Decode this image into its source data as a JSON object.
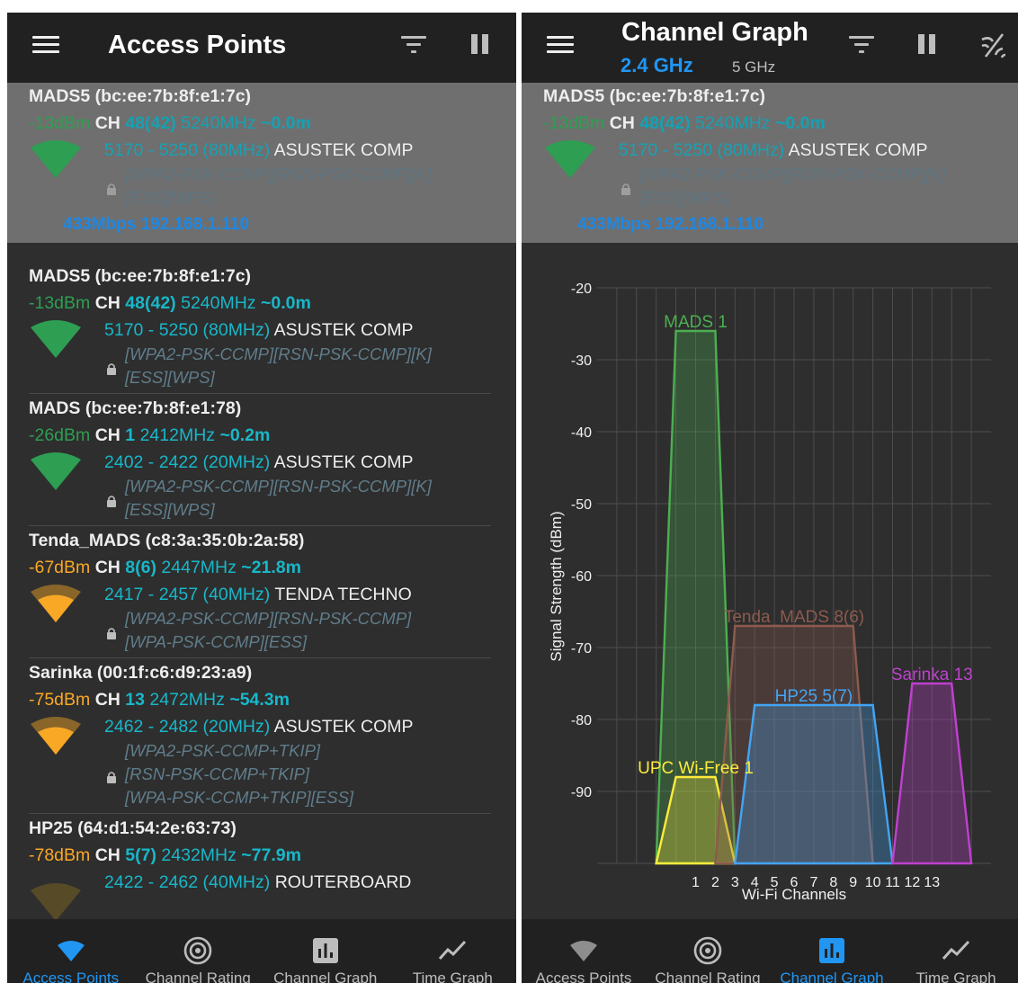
{
  "left_screen": {
    "title": "Access Points",
    "access_points": [
      {
        "name": "MADS5 (bc:ee:7b:8f:e1:7c)",
        "signal": "-13dBm",
        "ch_label": "CH",
        "channel": "48(42)",
        "frequency": "5240MHz",
        "distance": "~0.0m",
        "range": "5170 - 5250 (80MHz)",
        "vendor": "ASUSTEK COMP",
        "security_1": "[WPA2-PSK-CCMP][RSN-PSK-CCMP][K]",
        "security_2": "[ESS][WPS]",
        "extra": "433Mbps 192.168.1.110",
        "strength_color": "#2e9e52"
      },
      {
        "name": "MADS5 (bc:ee:7b:8f:e1:7c)",
        "signal": "-13dBm",
        "ch_label": "CH",
        "channel": "48(42)",
        "frequency": "5240MHz",
        "distance": "~0.0m",
        "range": "5170 - 5250 (80MHz)",
        "vendor": "ASUSTEK COMP",
        "security_1": "[WPA2-PSK-CCMP][RSN-PSK-CCMP][K]",
        "security_2": "[ESS][WPS]",
        "strength_color": "#2e9e52"
      },
      {
        "name": "MADS (bc:ee:7b:8f:e1:78)",
        "signal": "-26dBm",
        "ch_label": "CH",
        "channel": "1",
        "frequency": "2412MHz",
        "distance": "~0.2m",
        "range": "2402 - 2422 (20MHz)",
        "vendor": "ASUSTEK COMP",
        "security_1": "[WPA2-PSK-CCMP][RSN-PSK-CCMP][K]",
        "security_2": "[ESS][WPS]",
        "strength_color": "#2e9e52"
      },
      {
        "name": "Tenda_MADS (c8:3a:35:0b:2a:58)",
        "signal": "-67dBm",
        "ch_label": "CH",
        "channel": "8(6)",
        "frequency": "2447MHz",
        "distance": "~21.8m",
        "range": "2417 - 2457 (40MHz)",
        "vendor": "TENDA TECHNO",
        "security_1": "[WPA2-PSK-CCMP][RSN-PSK-CCMP]",
        "security_2": "[WPA-PSK-CCMP][ESS]",
        "strength_color": "#f9a825"
      },
      {
        "name": "Sarinka (00:1f:c6:d9:23:a9)",
        "signal": "-75dBm",
        "ch_label": "CH",
        "channel": "13",
        "frequency": "2472MHz",
        "distance": "~54.3m",
        "range": "2462 - 2482 (20MHz)",
        "vendor": "ASUSTEK COMP",
        "security_1": "[WPA2-PSK-CCMP+TKIP]",
        "security_2": "[RSN-PSK-CCMP+TKIP]",
        "security_3": "[WPA-PSK-CCMP+TKIP][ESS]",
        "strength_color": "#f9a825"
      },
      {
        "name": "HP25 (64:d1:54:2e:63:73)",
        "signal": "-78dBm",
        "ch_label": "CH",
        "channel": "5(7)",
        "frequency": "2432MHz",
        "distance": "~77.9m",
        "range": "2422 - 2462 (40MHz)",
        "vendor": "ROUTERBOARD",
        "strength_color": "#f9a825"
      }
    ]
  },
  "right_screen": {
    "title": "Channel Graph",
    "band_tabs": [
      "2.4 GHz",
      "5 GHz"
    ],
    "selected_ap": {
      "name": "MADS5 (bc:ee:7b:8f:e1:7c)",
      "signal": "-13dBm",
      "ch_label": "CH",
      "channel": "48(42)",
      "frequency": "5240MHz",
      "distance": "~0.0m",
      "range": "5170 - 5250 (80MHz)",
      "vendor": "ASUSTEK COMP",
      "security_1": "[WPA2-PSK-CCMP][RSN-PSK-CCMP][K]",
      "security_2": "[ESS][WPS]",
      "extra": "433Mbps 192.168.1.110"
    }
  },
  "chart_data": {
    "type": "area",
    "xlabel": "Wi-Fi Channels",
    "ylabel": "Signal Strength (dBm)",
    "xlim": [
      -4,
      16
    ],
    "ylim": [
      -100,
      -20
    ],
    "yticks": [
      -20,
      -30,
      -40,
      -50,
      -60,
      -70,
      -80,
      -90
    ],
    "xticks": [
      "1",
      "2",
      "3",
      "4",
      "5",
      "6",
      "7",
      "8",
      "9",
      "10",
      "11",
      "12",
      "13"
    ],
    "grid": true,
    "baseline": -100,
    "series": [
      {
        "name": "MADS 1",
        "color": "#4caf50",
        "left": -1,
        "top_start": 0,
        "top_end": 2,
        "right": 3,
        "level": -26
      },
      {
        "name": "UPC Wi-Free 1",
        "color": "#ffeb3b",
        "left": -1,
        "top_start": 0,
        "top_end": 2,
        "right": 3,
        "level": -88
      },
      {
        "name": "Tenda_MADS 8(6)",
        "color": "#8d5a4e",
        "left": 2,
        "top_start": 3,
        "top_end": 9,
        "right": 10,
        "level": -67
      },
      {
        "name": "HP25 5(7)",
        "color": "#42a5f5",
        "left": 3,
        "top_start": 4,
        "top_end": 10,
        "right": 11,
        "level": -78
      },
      {
        "name": "Sarinka 13",
        "color": "#c040d0",
        "left": 11,
        "top_start": 12,
        "top_end": 14,
        "right": 15,
        "level": -75
      }
    ]
  },
  "bottom_nav": {
    "items": [
      "Access Points",
      "Channel Rating",
      "Channel Graph",
      "Time Graph"
    ]
  }
}
